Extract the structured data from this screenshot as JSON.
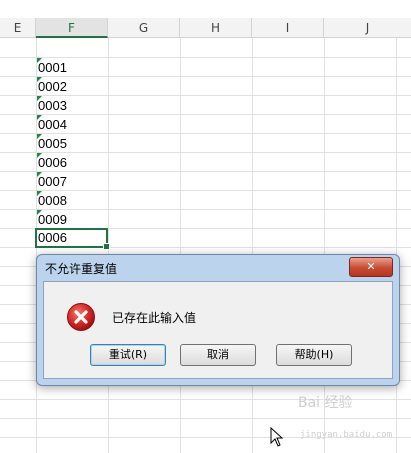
{
  "spreadsheet": {
    "columns": [
      "E",
      "F",
      "G",
      "H",
      "I",
      "J"
    ],
    "active_column": "F",
    "cells": [
      "0001",
      "0002",
      "0003",
      "0004",
      "0005",
      "0006",
      "0007",
      "0008",
      "0009"
    ],
    "selected_cell_value": "0006"
  },
  "dialog": {
    "title": "不允许重复值",
    "close_label": "✕",
    "message": "已存在此输入值",
    "buttons": {
      "retry": "重试(R)",
      "cancel": "取消",
      "help": "帮助(H)"
    }
  },
  "watermark": {
    "text": "Bai 经验",
    "sub": "jingyan.baidu.com"
  },
  "colors": {
    "accent": "#217346",
    "error": "#d42a2a"
  }
}
